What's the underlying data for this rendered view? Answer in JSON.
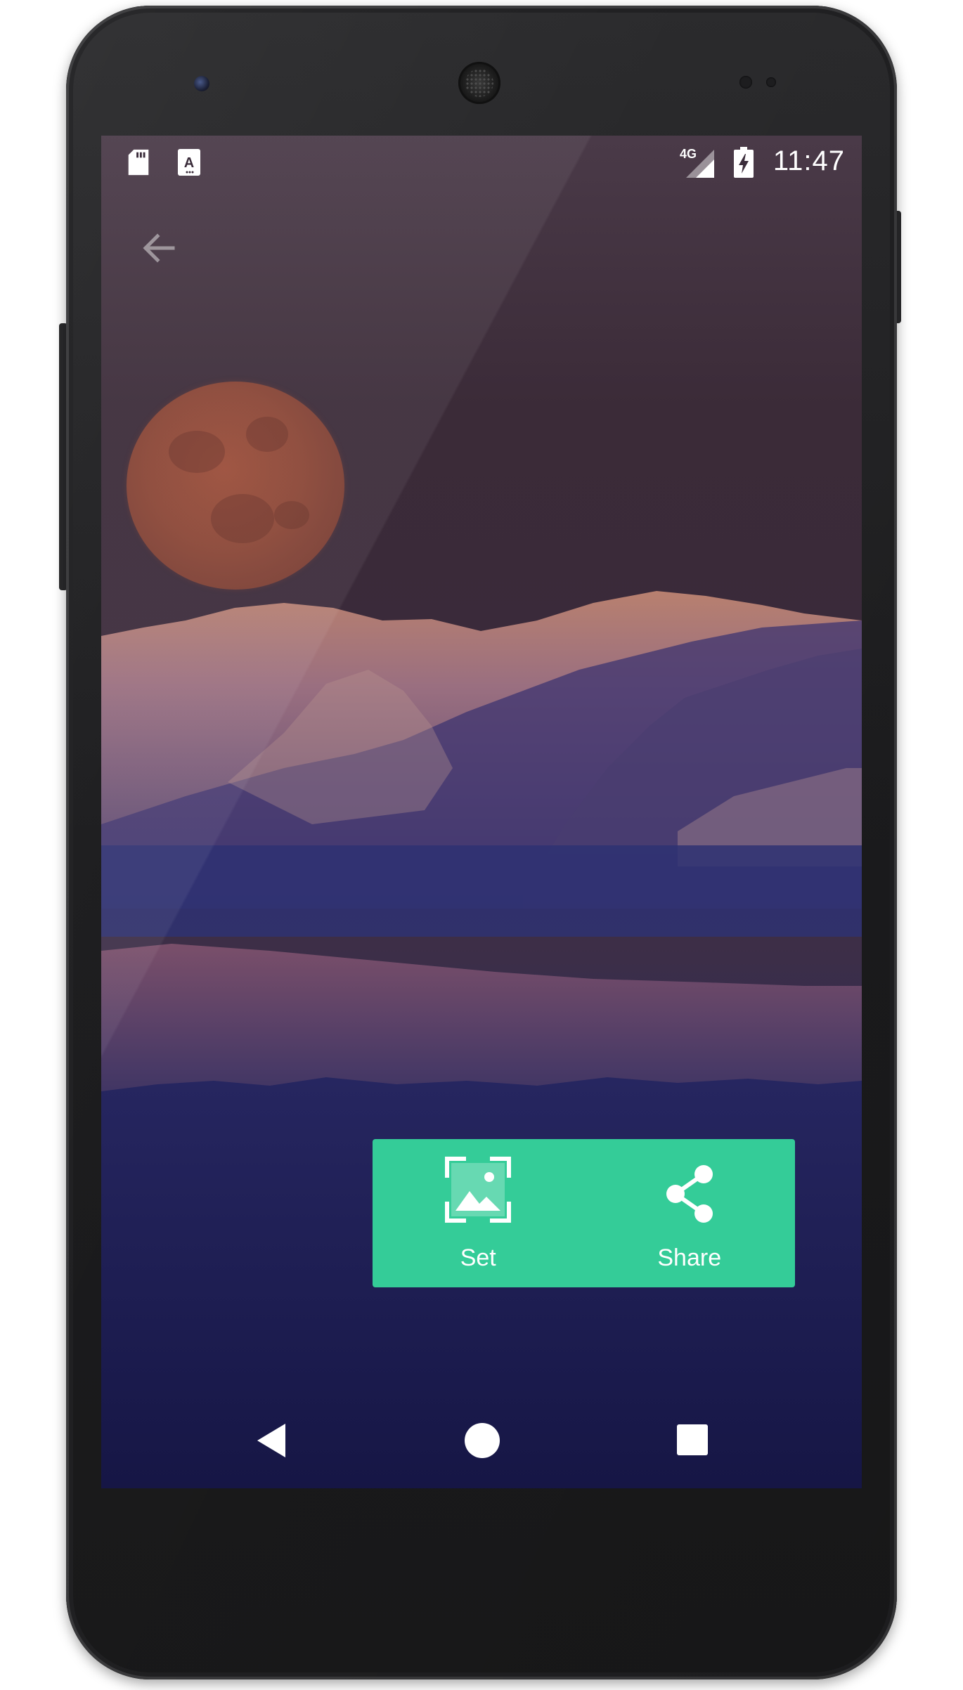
{
  "status_bar": {
    "time": "11:47",
    "network_type": "4G",
    "icons": [
      "sd-card-icon",
      "font-a-icon",
      "signal-icon",
      "battery-charging-icon"
    ]
  },
  "toolbar": {
    "back_icon": "arrow-back-icon"
  },
  "actions": {
    "set_label": "Set",
    "set_icon": "wallpaper-icon",
    "share_label": "Share",
    "share_icon": "share-icon"
  },
  "colors": {
    "accent": "#34cc98",
    "status_text": "#ffffff"
  },
  "navigation": {
    "items": [
      "back-triangle-icon",
      "home-circle-icon",
      "recents-square-icon"
    ]
  }
}
